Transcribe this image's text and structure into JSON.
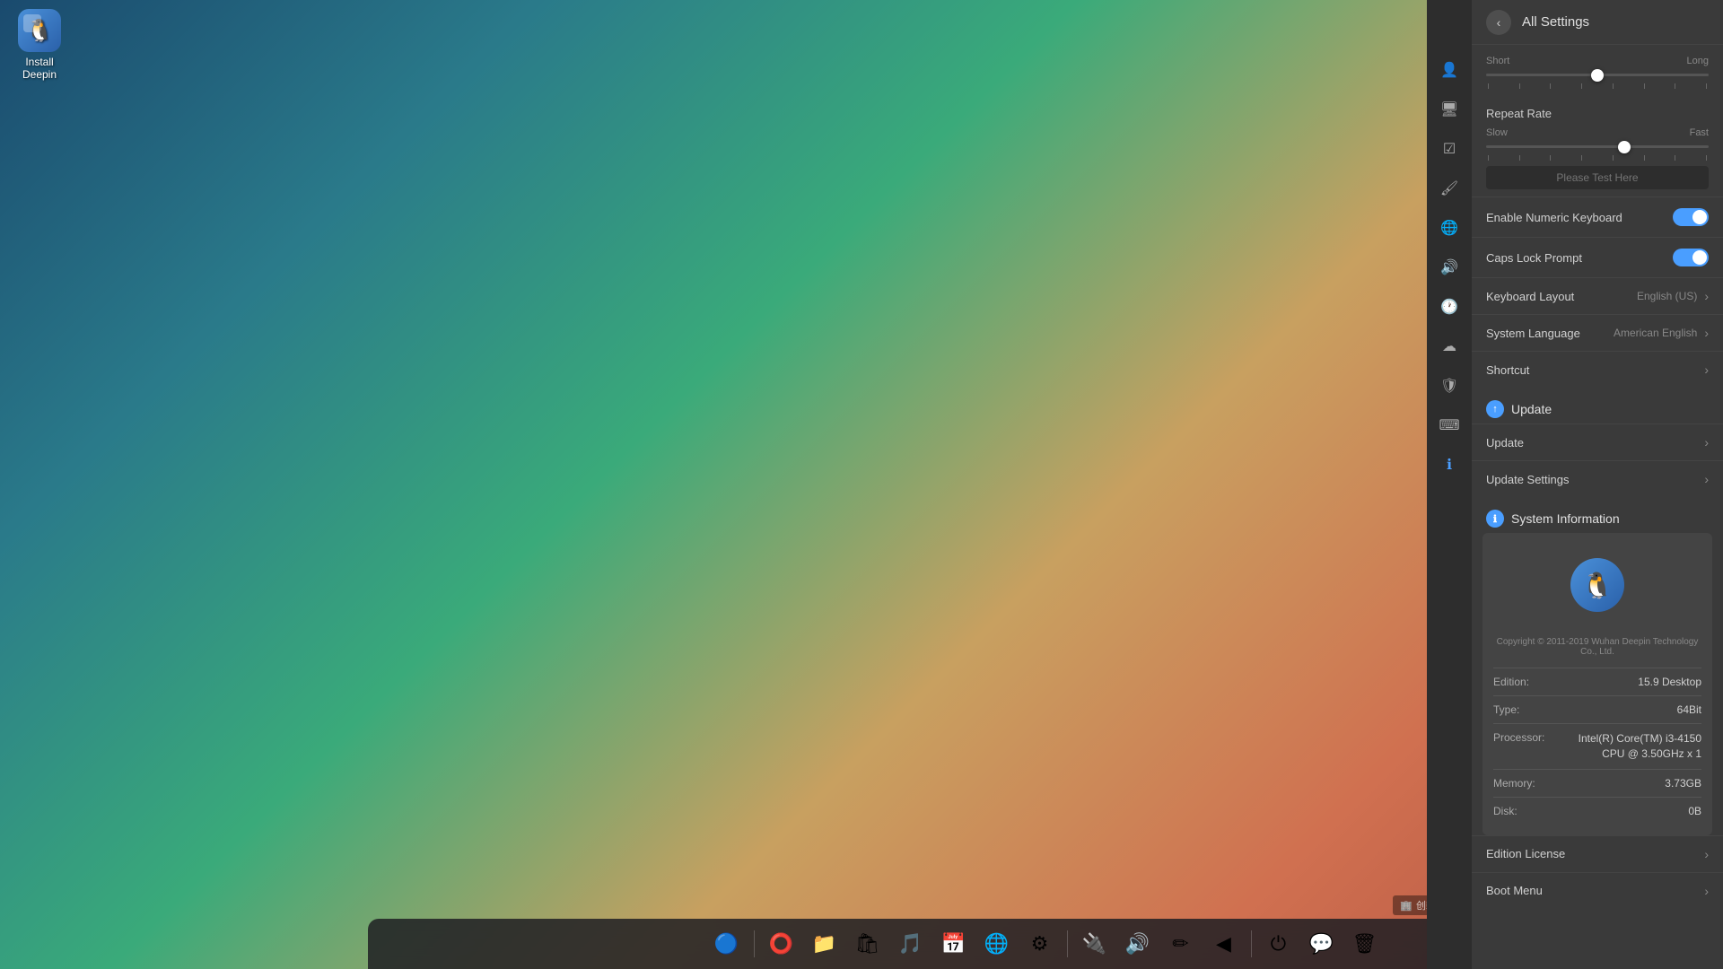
{
  "desktop": {
    "icon": {
      "label_line1": "Install",
      "label_line2": "Deepin"
    }
  },
  "settings_panel": {
    "title": "All Settings",
    "back_button_label": "‹",
    "delay_section": {
      "label": "Repeat Rate",
      "slow_label": "Slow",
      "fast_label": "Fast",
      "short_label": "Short",
      "long_label": "Long",
      "test_placeholder": "Please Test Here",
      "slider_position_pct": 62
    },
    "enable_numeric_keyboard": {
      "label": "Enable Numeric Keyboard",
      "enabled": true
    },
    "caps_lock_prompt": {
      "label": "Caps Lock Prompt",
      "enabled": true
    },
    "keyboard_layout": {
      "label": "Keyboard Layout",
      "value": "English (US)"
    },
    "system_language": {
      "label": "System Language",
      "value": "American English"
    },
    "shortcut": {
      "label": "Shortcut"
    },
    "update_section": {
      "title": "Update",
      "update_item": "Update",
      "update_settings_item": "Update Settings"
    },
    "system_info_section": {
      "title": "System Information",
      "copyright": "Copyright © 2011-2019 Wuhan Deepin Technology Co., Ltd.",
      "edition_label": "Edition:",
      "edition_value": "15.9 Desktop",
      "type_label": "Type:",
      "type_value": "64Bit",
      "processor_label": "Processor:",
      "processor_value": "Intel(R) Core(TM) i3-4150 CPU @ 3.50GHz x 1",
      "memory_label": "Memory:",
      "memory_value": "3.73GB",
      "disk_label": "Disk:",
      "disk_value": "0B"
    },
    "edition_license": {
      "label": "Edition License"
    },
    "boot_menu": {
      "label": "Boot Menu"
    }
  },
  "sidebar": {
    "icons": [
      {
        "name": "person-icon",
        "symbol": "👤",
        "active": false
      },
      {
        "name": "monitor-icon",
        "symbol": "🖥",
        "active": false
      },
      {
        "name": "checkbox-icon",
        "symbol": "☑",
        "active": false
      },
      {
        "name": "brush-icon",
        "symbol": "🖌",
        "active": false
      },
      {
        "name": "globe-icon",
        "symbol": "🌐",
        "active": false
      },
      {
        "name": "volume-icon",
        "symbol": "🔊",
        "active": false
      },
      {
        "name": "clock-icon",
        "symbol": "🕐",
        "active": false
      },
      {
        "name": "cloud-icon",
        "symbol": "☁",
        "active": false
      },
      {
        "name": "shield-icon",
        "symbol": "🛡",
        "active": false
      },
      {
        "name": "keyboard-icon",
        "symbol": "⌨",
        "active": false
      },
      {
        "name": "info-icon",
        "symbol": "ℹ",
        "active": true
      }
    ]
  },
  "taskbar": {
    "items": [
      {
        "name": "deepin-launcher",
        "symbol": "🔵"
      },
      {
        "name": "screenshot-tool",
        "symbol": "⭕"
      },
      {
        "name": "file-manager",
        "symbol": "📁"
      },
      {
        "name": "appstore",
        "symbol": "🛍"
      },
      {
        "name": "music-player",
        "symbol": "🎵"
      },
      {
        "name": "calendar",
        "symbol": "📅"
      },
      {
        "name": "chrome-browser",
        "symbol": "🌐"
      },
      {
        "name": "system-settings",
        "symbol": "⚙"
      },
      {
        "name": "usb-device",
        "symbol": "🔌"
      },
      {
        "name": "volume-control",
        "symbol": "🔊"
      },
      {
        "name": "pen-tool",
        "symbol": "✏"
      },
      {
        "name": "back-button",
        "symbol": "◀"
      },
      {
        "name": "power-button",
        "symbol": "⏻"
      },
      {
        "name": "wechat",
        "symbol": "💬"
      },
      {
        "name": "trash",
        "symbol": "🗑"
      }
    ]
  },
  "watermark": {
    "text": "创新互联"
  }
}
